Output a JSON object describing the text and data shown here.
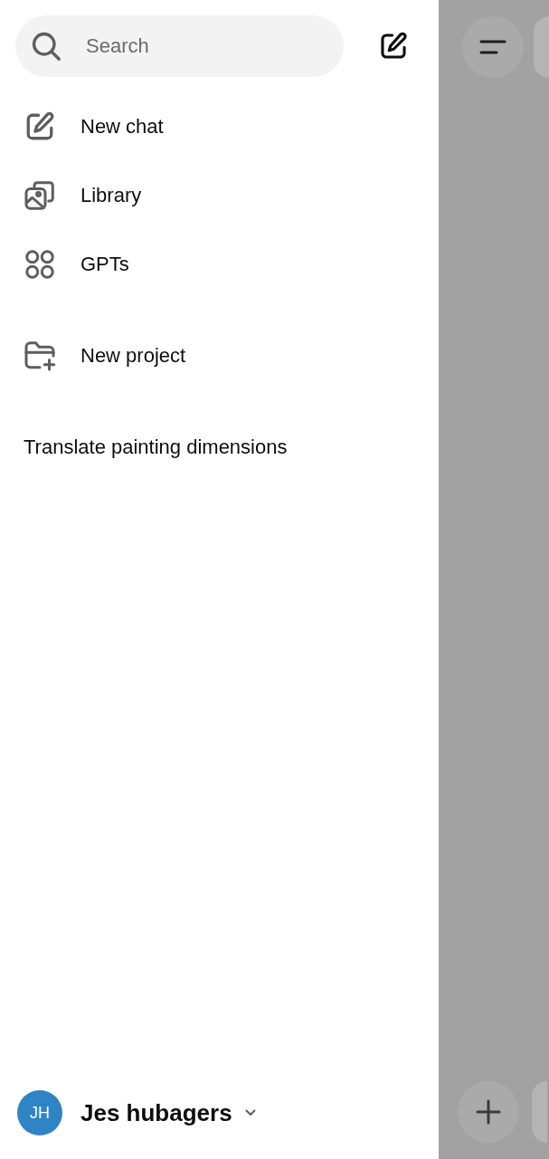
{
  "search": {
    "placeholder": "Search"
  },
  "nav_items": [
    {
      "label": "New chat"
    },
    {
      "label": "Library"
    },
    {
      "label": "GPTs"
    }
  ],
  "projects": [
    {
      "label": "New project"
    }
  ],
  "chats": [
    {
      "title": "Translate painting dimensions"
    }
  ],
  "account": {
    "initials": "JH",
    "name": "Jes hubagers"
  }
}
